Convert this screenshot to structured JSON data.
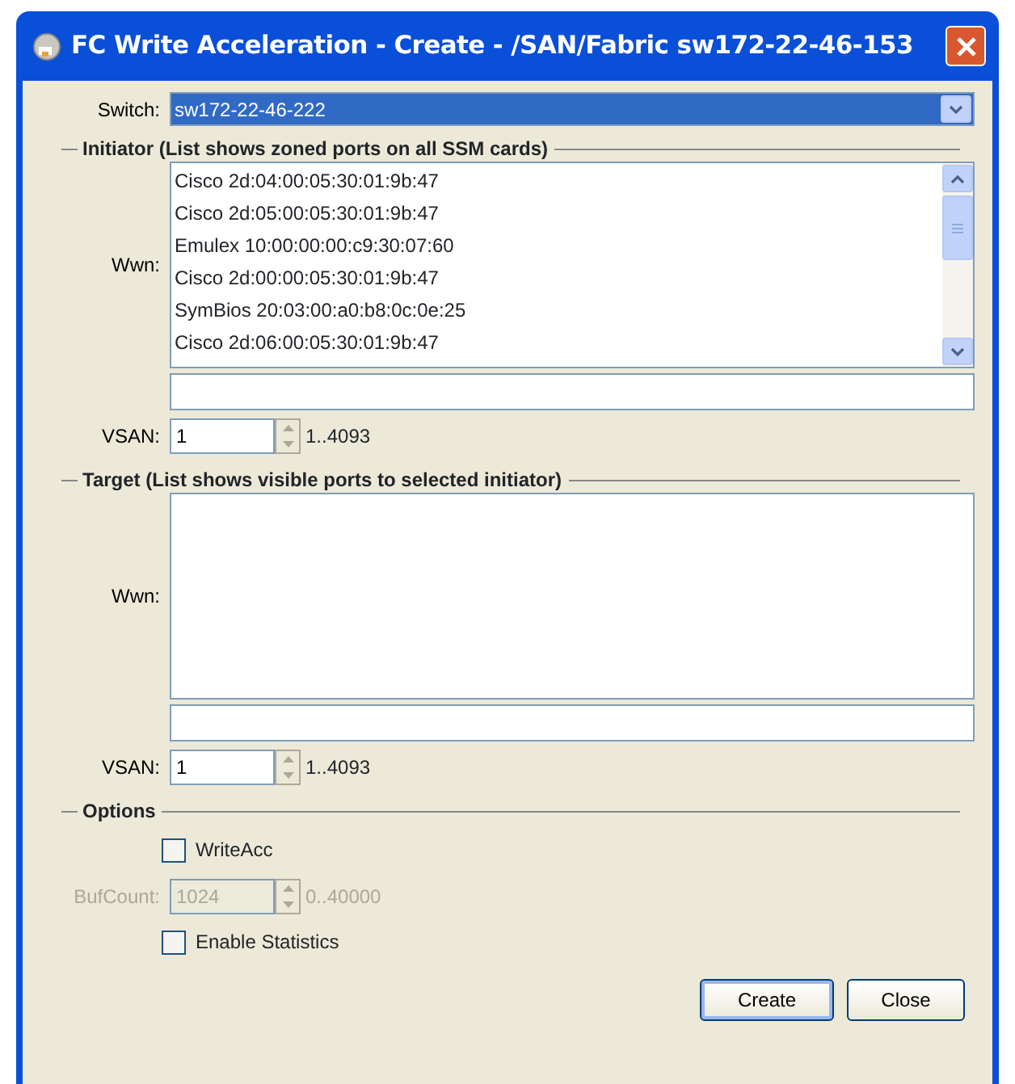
{
  "window": {
    "title": "FC Write Acceleration - Create - /SAN/Fabric sw172-22-46-153"
  },
  "switch": {
    "label": "Switch:",
    "value": "sw172-22-46-222"
  },
  "initiator": {
    "heading": "Initiator (List shows zoned ports on all SSM cards)",
    "wwn_label": "Wwn:",
    "items": [
      {
        "text": "Cisco 2d:04:00:05:30:01:9b:47",
        "selected": false
      },
      {
        "text": "Cisco 2d:05:00:05:30:01:9b:47",
        "selected": false
      },
      {
        "text": "Emulex 10:00:00:00:c9:30:07:60",
        "selected": false
      },
      {
        "text": "Cisco 2d:00:00:05:30:01:9b:47",
        "selected": false
      },
      {
        "text": "SymBios 20:03:00:a0:b8:0c:0e:25",
        "selected": false
      },
      {
        "text": "Cisco 2d:06:00:05:30:01:9b:47",
        "selected": false
      }
    ],
    "vsan": {
      "label": "VSAN:",
      "value": "1",
      "range": "1..4093"
    }
  },
  "target": {
    "heading": "Target (List shows visible ports to selected initiator)",
    "wwn_label": "Wwn:",
    "vsan": {
      "label": "VSAN:",
      "value": "1",
      "range": "1..4093"
    }
  },
  "options": {
    "heading": "Options",
    "items": [
      {
        "kind": "checkbox",
        "label": "WriteAcc",
        "checked": false
      },
      {
        "kind": "spinner",
        "label": "BufCount:",
        "value": "1024",
        "range": "0..40000",
        "disabled": true
      },
      {
        "kind": "checkbox",
        "label": "Enable Statistics",
        "checked": false
      }
    ]
  },
  "buttons": [
    {
      "label": "Create",
      "default": true
    },
    {
      "label": "Close",
      "default": false
    }
  ]
}
